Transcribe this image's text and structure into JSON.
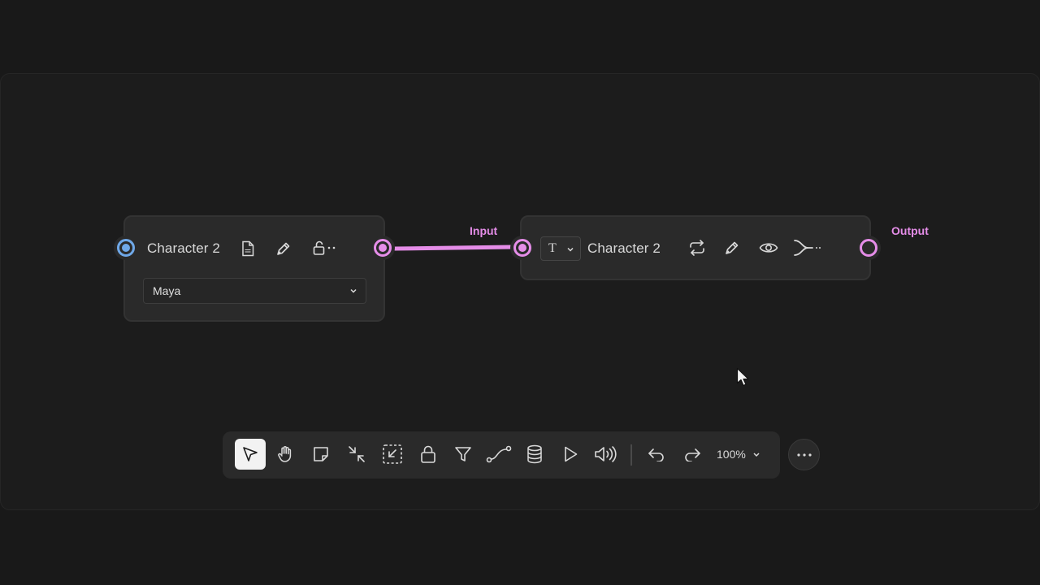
{
  "node_source": {
    "title": "Character 2",
    "select_value": "Maya",
    "icons": [
      "csv-file-icon",
      "pen-icon",
      "unlock-icon",
      "more-dots-icon"
    ]
  },
  "node_target": {
    "title": "Character 2",
    "type_button_glyph": "T",
    "icons": [
      "repeat-icon",
      "pen-icon",
      "eye-icon",
      "merge-icon"
    ]
  },
  "edge": {
    "input_label": "Input",
    "output_label": "Output"
  },
  "toolbar": {
    "zoom": "100%",
    "tools": [
      "pointer",
      "hand",
      "sticky-note",
      "collapse",
      "selection-frame",
      "lock",
      "filter",
      "connector",
      "database",
      "play",
      "volume",
      "undo",
      "redo"
    ],
    "active_tool": "pointer"
  },
  "colors": {
    "accent": "#e58de8",
    "port_blue": "#6fa8e8",
    "background": "#191919",
    "node": "#2a2a2a"
  }
}
